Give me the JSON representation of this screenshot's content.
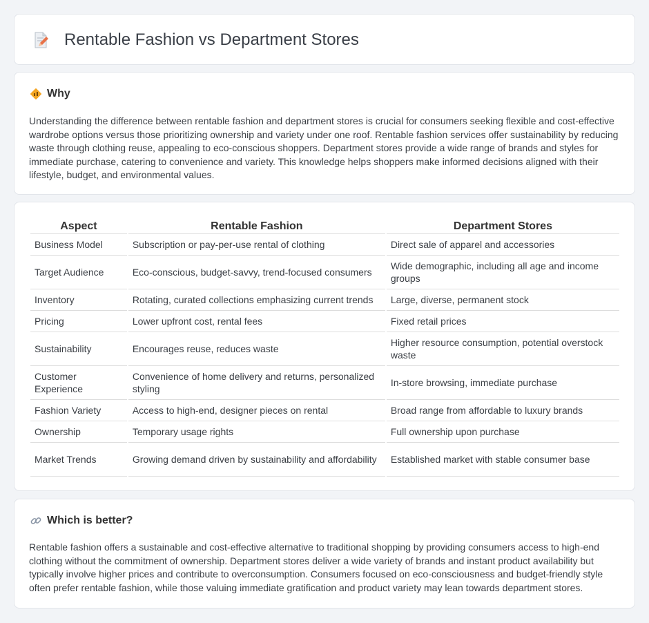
{
  "header": {
    "title": "Rentable Fashion vs Department Stores",
    "icon": "document-pencil-icon"
  },
  "why": {
    "title": "Why",
    "icon": "diamond-sign-icon",
    "text": "Understanding the difference between rentable fashion and department stores is crucial for consumers seeking flexible and cost-effective wardrobe options versus those prioritizing ownership and variety under one roof. Rentable fashion services offer sustainability by reducing waste through clothing reuse, appealing to eco-conscious shoppers. Department stores provide a wide range of brands and styles for immediate purchase, catering to convenience and variety. This knowledge helps shoppers make informed decisions aligned with their lifestyle, budget, and environmental values."
  },
  "comparison": {
    "headers": [
      "Aspect",
      "Rentable Fashion",
      "Department Stores"
    ],
    "rows": [
      [
        "Business Model",
        "Subscription or pay-per-use rental of clothing",
        "Direct sale of apparel and accessories"
      ],
      [
        "Target Audience",
        "Eco-conscious, budget-savvy, trend-focused consumers",
        "Wide demographic, including all age and income groups"
      ],
      [
        "Inventory",
        "Rotating, curated collections emphasizing current trends",
        "Large, diverse, permanent stock"
      ],
      [
        "Pricing",
        "Lower upfront cost, rental fees",
        "Fixed retail prices"
      ],
      [
        "Sustainability",
        "Encourages reuse, reduces waste",
        "Higher resource consumption, potential overstock waste"
      ],
      [
        "Customer Experience",
        "Convenience of home delivery and returns, personalized styling",
        "In-store browsing, immediate purchase"
      ],
      [
        "Fashion Variety",
        "Access to high-end, designer pieces on rental",
        "Broad range from affordable to luxury brands"
      ],
      [
        "Ownership",
        "Temporary usage rights",
        "Full ownership upon purchase"
      ],
      [
        "Market Trends",
        "Growing demand driven by sustainability and affordability",
        "Established market with stable consumer base"
      ]
    ]
  },
  "better": {
    "title": "Which is better?",
    "icon": "link-icon",
    "text": "Rentable fashion offers a sustainable and cost-effective alternative to traditional shopping by providing consumers access to high-end clothing without the commitment of ownership. Department stores deliver a wide variety of brands and instant product availability but typically involve higher prices and contribute to overconsumption. Consumers focused on eco-consciousness and budget-friendly style often prefer rentable fashion, while those valuing immediate gratification and product variety may lean towards department stores."
  },
  "colors": {
    "background": "#f2f4f7",
    "card": "#ffffff",
    "accent": "#f39c12"
  }
}
